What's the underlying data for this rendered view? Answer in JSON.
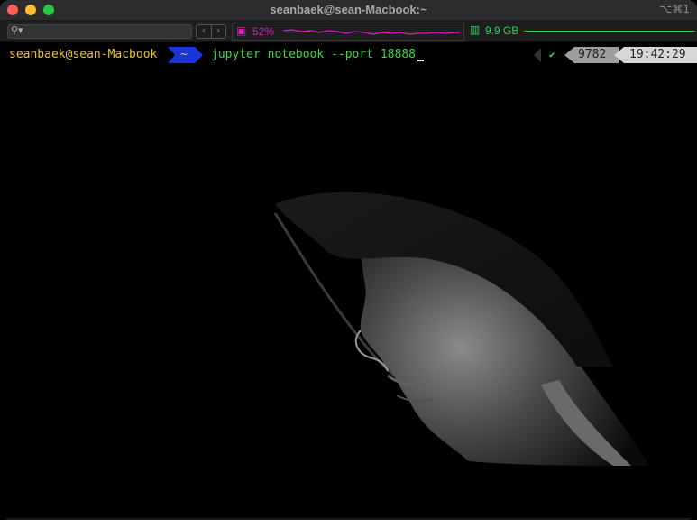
{
  "window": {
    "title": "seanbaek@sean-Macbook:~",
    "shortcut": "⌥⌘1"
  },
  "statusbar": {
    "search_icon": "search-icon",
    "back_icon": "‹",
    "forward_icon": "›",
    "cpu": {
      "icon": "cpu-chip-icon",
      "label": "52%",
      "color": "#d81fbd",
      "usage_fraction": 0.52
    },
    "memory": {
      "icon": "memory-icon",
      "label": "9.9 GB",
      "color": "#2bd15a"
    }
  },
  "prompt": {
    "user_host": "seanbaek@sean-Macbook",
    "directory": "~",
    "command": "jupyter notebook --port 18888",
    "status_check": "✔",
    "pid": "9782",
    "time": "19:42:29"
  },
  "colors": {
    "user": "#e5c62c",
    "dir_segment": "#1a35d9",
    "command": "#3fd63f",
    "pid_segment": "#9e9e9e",
    "time_segment": "#d7d7d7"
  },
  "background": "hooded-face-wallpaper"
}
